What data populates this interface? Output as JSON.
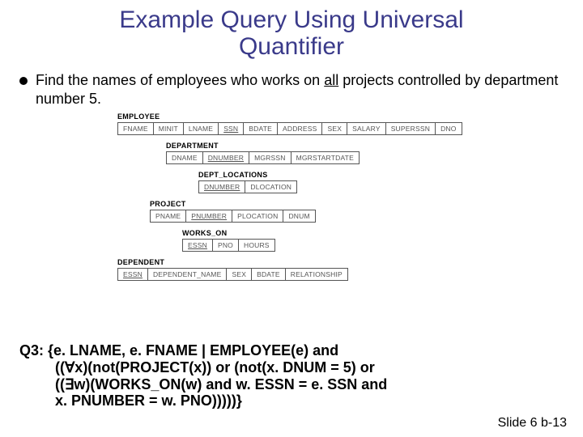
{
  "title_line1": "Example Query Using Universal",
  "title_line2": "Quantifier",
  "bullet_pre": "Find the names of employees who works on ",
  "bullet_all": "all",
  "bullet_post": " projects controlled by department number 5.",
  "schemas": {
    "employee": {
      "label": "EMPLOYEE",
      "cols": [
        "FNAME",
        "MINIT",
        "LNAME",
        "SSN",
        "BDATE",
        "ADDRESS",
        "SEX",
        "SALARY",
        "SUPERSSN",
        "DNO"
      ],
      "key_idx": 3
    },
    "department": {
      "label": "DEPARTMENT",
      "cols": [
        "DNAME",
        "DNUMBER",
        "MGRSSN",
        "MGRSTARTDATE"
      ],
      "key_idx": 1
    },
    "dept_locations": {
      "label": "DEPT_LOCATIONS",
      "cols": [
        "DNUMBER",
        "DLOCATION"
      ],
      "key_idx": 0
    },
    "project": {
      "label": "PROJECT",
      "cols": [
        "PNAME",
        "PNUMBER",
        "PLOCATION",
        "DNUM"
      ],
      "key_idx": 1
    },
    "works_on": {
      "label": "WORKS_ON",
      "cols": [
        "ESSN",
        "PNO",
        "HOURS"
      ],
      "key_idx": 0
    },
    "dependent": {
      "label": "DEPENDENT",
      "cols": [
        "ESSN",
        "DEPENDENT_NAME",
        "SEX",
        "BDATE",
        "RELATIONSHIP"
      ],
      "key_idx": 0
    }
  },
  "q3": {
    "label": "Q3: ",
    "l1": "{e. LNAME, e. FNAME | EMPLOYEE(e) and",
    "l2": "((∀x)(not(PROJECT(x)) or (not(x. DNUM = 5) or",
    "l3": "((∃w)(WORKS_ON(w) and w. ESSN = e. SSN and",
    "l4": "x. PNUMBER = w. PNO)))))}"
  },
  "footer": "Slide 6 b-13"
}
